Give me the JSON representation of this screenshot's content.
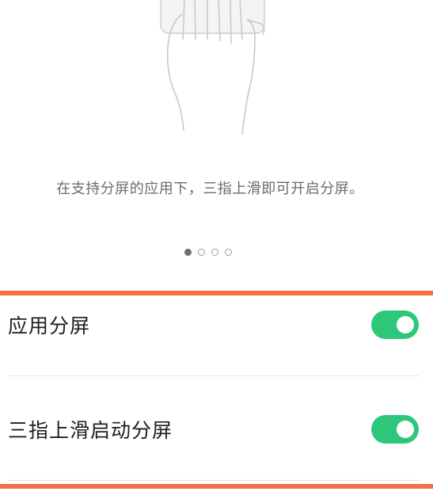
{
  "colors": {
    "accent": "#f36f44",
    "toggle_on": "#2ec77a"
  },
  "guide": {
    "illustration_icon": "three-finger-swipe-hand-icon",
    "caption": "在支持分屏的应用下，三指上滑即可开启分屏。",
    "page_indicator": {
      "total": 4,
      "current": 1
    }
  },
  "settings": [
    {
      "label": "应用分屏",
      "enabled": true
    },
    {
      "label": "三指上滑启动分屏",
      "enabled": true
    }
  ]
}
